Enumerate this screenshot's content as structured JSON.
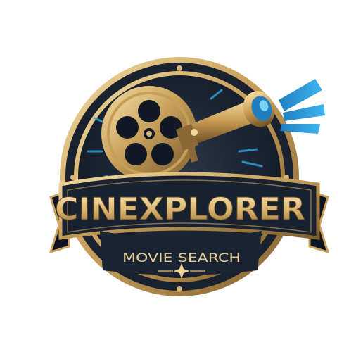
{
  "logo": {
    "brand_name": "CINEXPLORER",
    "tagline": "MOVIE SEARCH",
    "icons": {
      "reel": "film-reel-icon",
      "telescope": "telescope-icon",
      "light": "light-beam-icon",
      "sparkle": "sparkle-icon"
    },
    "colors": {
      "background": "#ffffff",
      "gold": "#c9a15c",
      "gold_light": "#f1d79b",
      "gold_dark": "#7e5f2e",
      "navy": "#1b2433",
      "navy_dark": "#0f1520",
      "blue": "#2f9fd8",
      "blue_light": "#7fd3f5"
    }
  }
}
